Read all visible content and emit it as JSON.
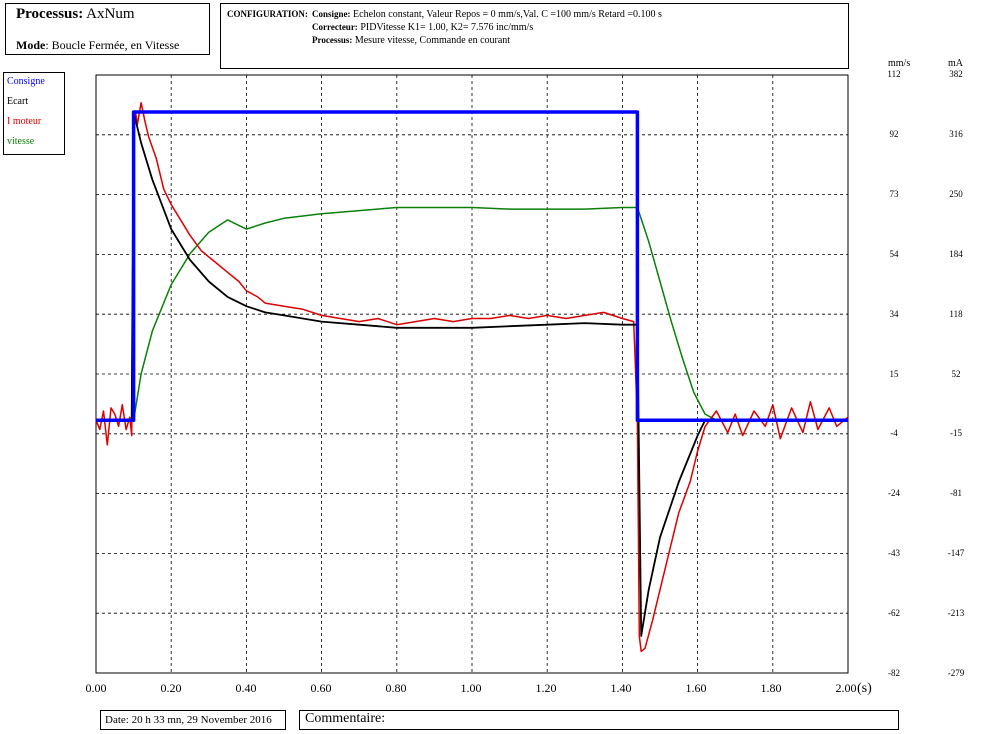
{
  "header": {
    "process_label": "Processus:",
    "process_value": "AxNum",
    "mode_label": "Mode",
    "mode_value": ": Boucle Fermée, en Vitesse"
  },
  "config": {
    "title": "CONFIGURATION:",
    "lines": [
      {
        "key": "Consigne:",
        "value": " Echelon constant, Valeur Repos = 0 mm/s,Val. C =100 mm/s Retard =0.100 s"
      },
      {
        "key": "Correcteur:",
        "value": " PIDVitesse K1= 1.00, K2= 7.576 inc/mm/s"
      },
      {
        "key": "Processus:",
        "value": "  Mesure vitesse, Commande en courant"
      }
    ]
  },
  "footer": {
    "date": "Date: 20 h 33 mn, 29 November 2016",
    "comment_label": "Commentaire:"
  },
  "chart_data": {
    "type": "line",
    "xlabel": "(s)",
    "xlim": [
      0,
      2
    ],
    "x_ticks": [
      "0.00",
      "0.20",
      "0.40",
      "0.60",
      "0.80",
      "1.00",
      "1.20",
      "1.40",
      "1.60",
      "1.80",
      "2.00"
    ],
    "y_left_unit": "mm/s",
    "y_right_unit": "mA",
    "y_left_ticks": [
      "112",
      "92",
      "73",
      "54",
      "34",
      "15",
      "-4",
      "-24",
      "-43",
      "-62",
      "-82"
    ],
    "y_right_ticks": [
      "382",
      "316",
      "250",
      "184",
      "118",
      "52",
      "-15",
      "-81",
      "-147",
      "-213",
      "-279"
    ],
    "ylim_left": [
      -82,
      112
    ],
    "grid": true,
    "legend_position": "left-outside",
    "series": [
      {
        "name": "Consigne",
        "color": "#0000ff",
        "x": [
          0,
          0.1,
          0.1,
          1.44,
          1.44,
          2.0
        ],
        "y": [
          0,
          0,
          100,
          100,
          0,
          0
        ]
      },
      {
        "name": "Ecart",
        "color": "#000000",
        "x": [
          0,
          0.095,
          0.1,
          0.12,
          0.15,
          0.2,
          0.25,
          0.3,
          0.35,
          0.4,
          0.45,
          0.5,
          0.55,
          0.6,
          0.7,
          0.8,
          0.9,
          1.0,
          1.1,
          1.2,
          1.3,
          1.4,
          1.44,
          1.45,
          1.47,
          1.5,
          1.55,
          1.6,
          1.62,
          1.65,
          2.0
        ],
        "y": [
          0,
          0,
          100,
          90,
          78,
          62,
          52,
          45,
          40,
          37,
          35,
          34,
          33,
          32,
          31,
          30,
          30,
          30,
          30.5,
          31,
          31.5,
          31,
          31,
          -70,
          -55,
          -38,
          -20,
          -5,
          0,
          0,
          0
        ]
      },
      {
        "name": "I moteur",
        "color": "#dd0000",
        "x": [
          0,
          0.01,
          0.02,
          0.03,
          0.04,
          0.05,
          0.06,
          0.07,
          0.08,
          0.09,
          0.095,
          0.1,
          0.105,
          0.11,
          0.12,
          0.13,
          0.14,
          0.16,
          0.18,
          0.2,
          0.22,
          0.25,
          0.28,
          0.3,
          0.32,
          0.35,
          0.38,
          0.4,
          0.43,
          0.45,
          0.5,
          0.55,
          0.6,
          0.65,
          0.7,
          0.75,
          0.8,
          0.85,
          0.9,
          0.95,
          1.0,
          1.05,
          1.1,
          1.15,
          1.2,
          1.25,
          1.3,
          1.35,
          1.4,
          1.43,
          1.44,
          1.445,
          1.45,
          1.46,
          1.48,
          1.5,
          1.52,
          1.55,
          1.58,
          1.6,
          1.62,
          1.65,
          1.68,
          1.7,
          1.72,
          1.75,
          1.78,
          1.8,
          1.82,
          1.85,
          1.88,
          1.9,
          1.92,
          1.95,
          1.97,
          2.0
        ],
        "y": [
          0,
          -3,
          3,
          -8,
          4,
          2,
          -2,
          5,
          -3,
          1,
          -5,
          95,
          100,
          96,
          103,
          97,
          92,
          85,
          75,
          70,
          66,
          60,
          55,
          53,
          51,
          48,
          45,
          42,
          40,
          38,
          37,
          36,
          34,
          33,
          32,
          33,
          31,
          32,
          33,
          32,
          33,
          33,
          34,
          33,
          34,
          33,
          34,
          35,
          33,
          32,
          0,
          -70,
          -75,
          -74,
          -65,
          -55,
          -45,
          -30,
          -20,
          -10,
          -2,
          3,
          -4,
          2,
          -5,
          3,
          -2,
          5,
          -6,
          4,
          -4,
          6,
          -3,
          4,
          -2,
          1
        ]
      },
      {
        "name": "vitesse",
        "color": "#0a800a",
        "x": [
          0,
          0.1,
          0.12,
          0.15,
          0.2,
          0.25,
          0.3,
          0.35,
          0.4,
          0.45,
          0.5,
          0.6,
          0.7,
          0.8,
          0.9,
          1.0,
          1.1,
          1.2,
          1.3,
          1.4,
          1.44,
          1.47,
          1.5,
          1.53,
          1.56,
          1.59,
          1.62,
          1.65,
          2.0
        ],
        "y": [
          0,
          0,
          15,
          29,
          44,
          54,
          61,
          65,
          62,
          64,
          65.5,
          67,
          68,
          69,
          69,
          69,
          68.5,
          68.5,
          68.5,
          69,
          69,
          58,
          45,
          32,
          20,
          9,
          2,
          0,
          0
        ]
      }
    ]
  }
}
